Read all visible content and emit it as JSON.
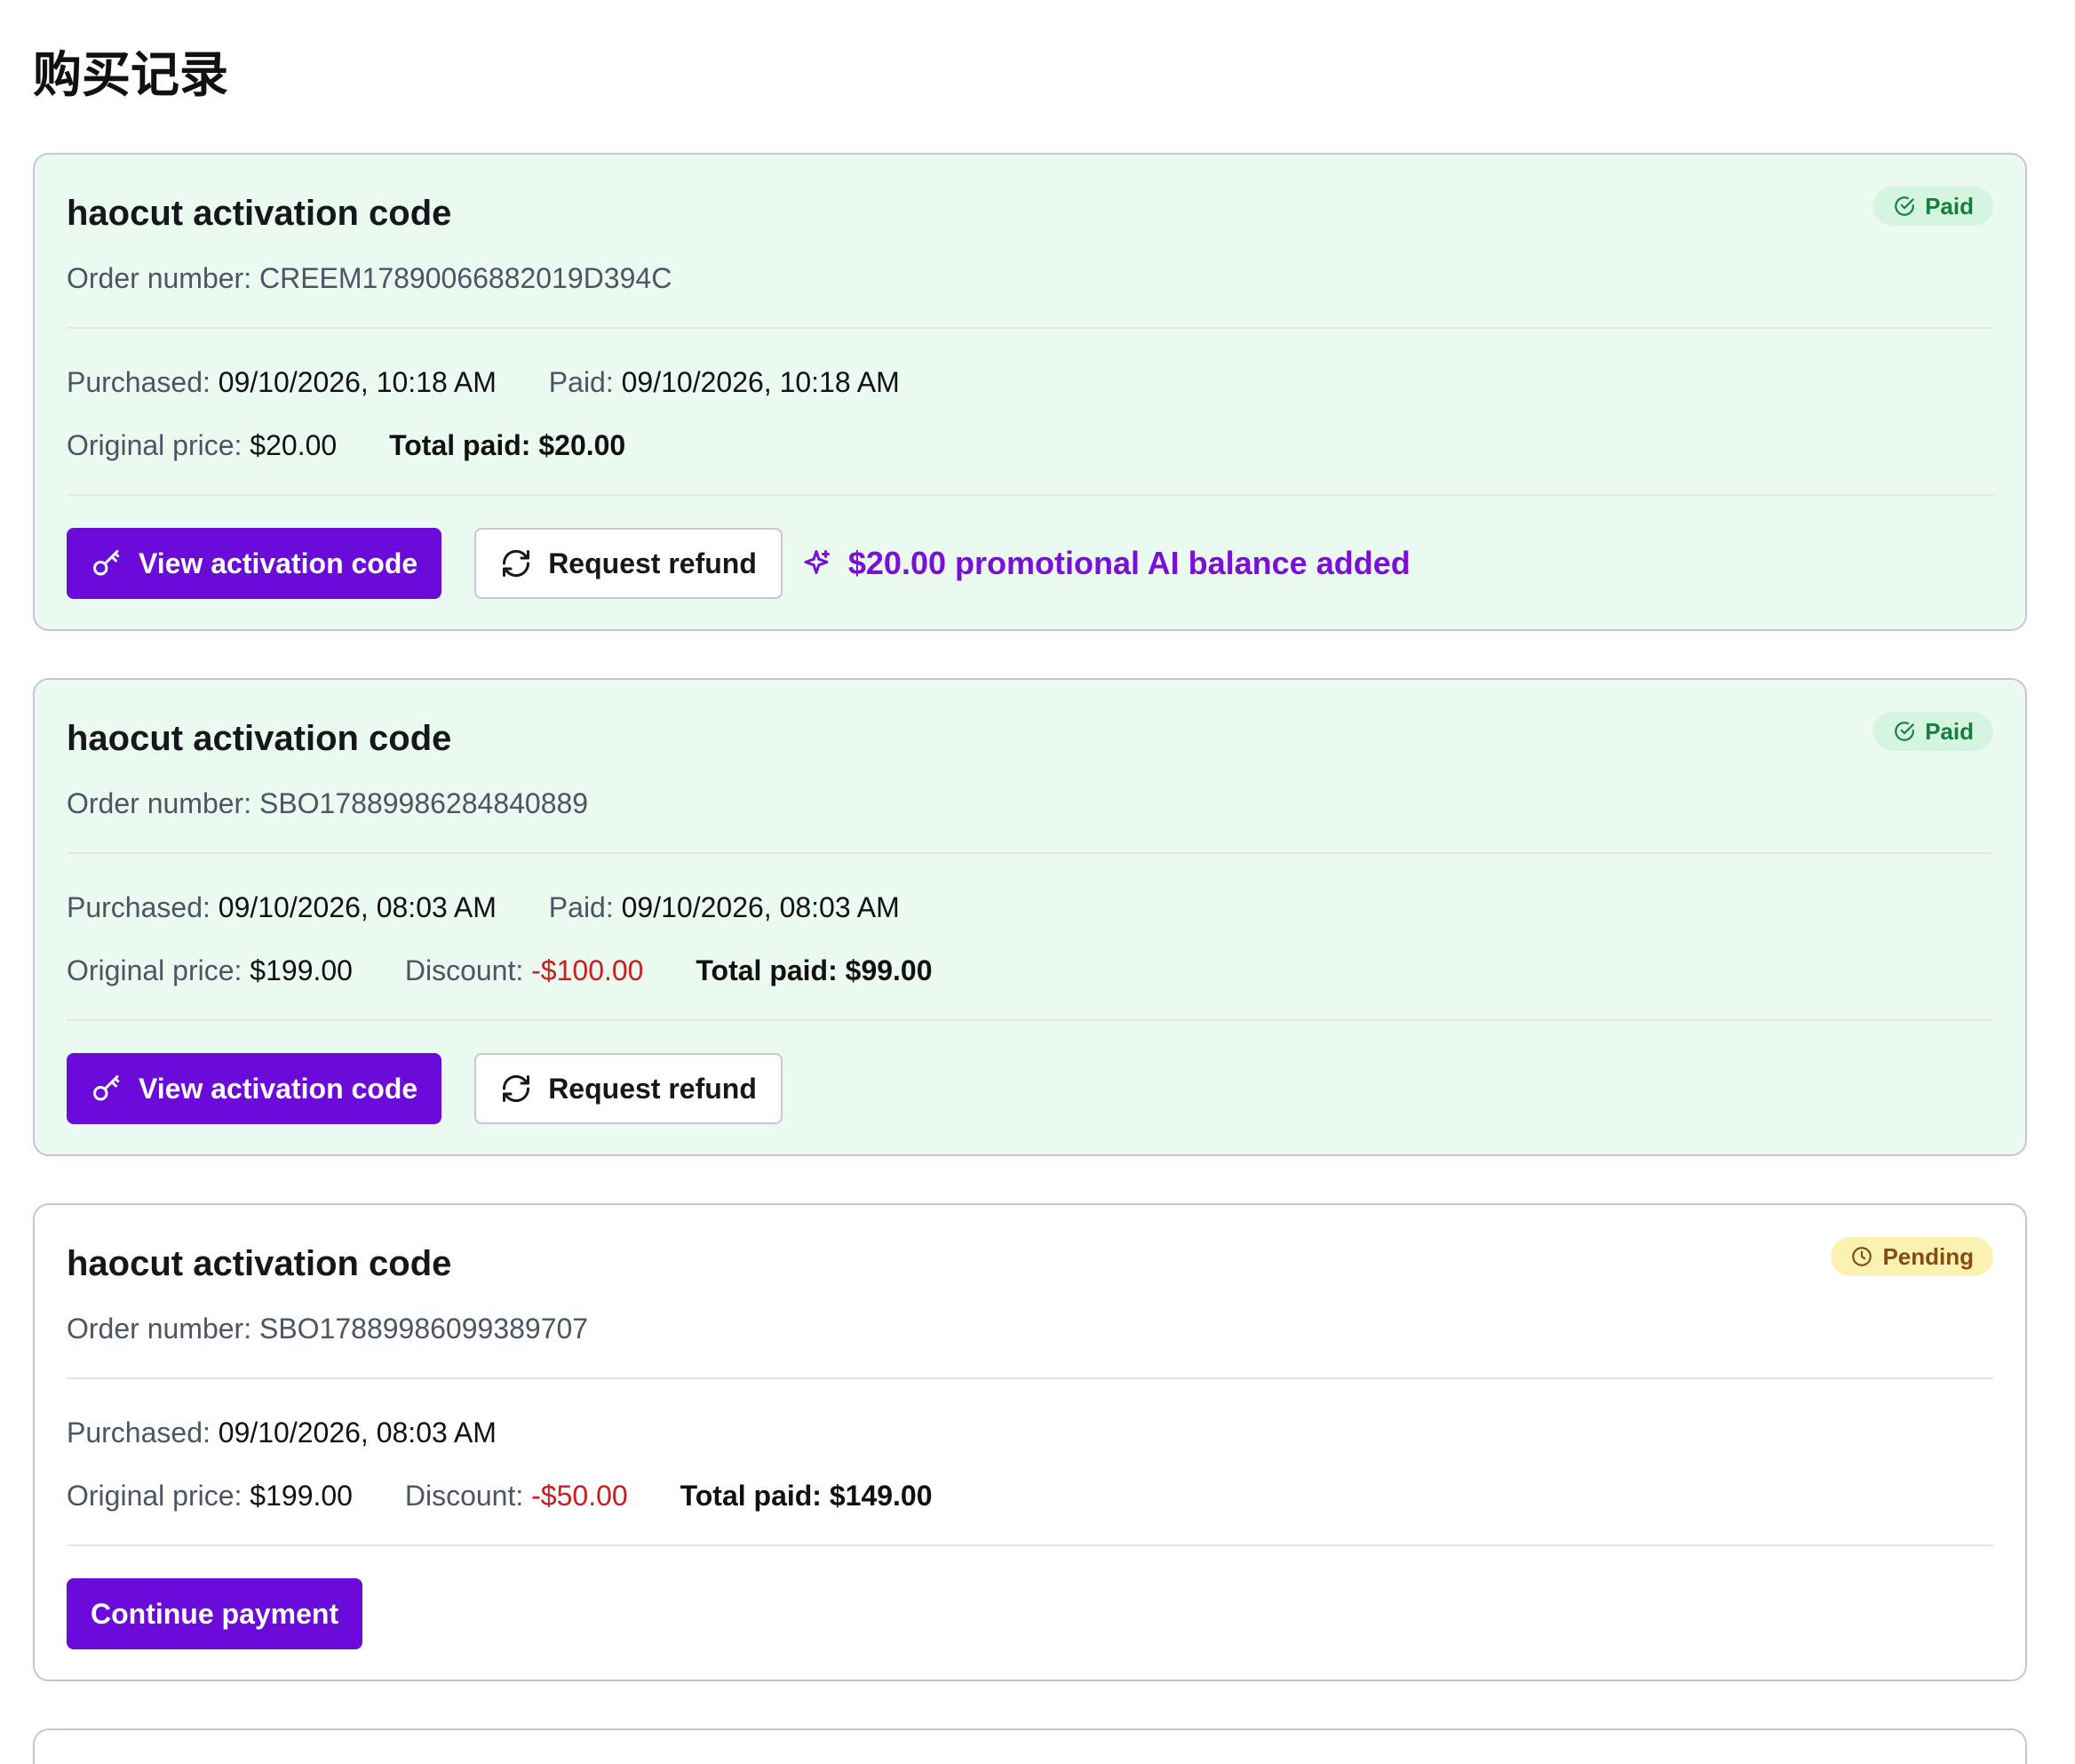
{
  "page": {
    "title": "购买记录"
  },
  "orders": [
    {
      "status": "paid",
      "status_label": "Paid",
      "title": "haocut activation code",
      "order_number": "Order number: CREEM17890066882019D394C",
      "purchased_label": "Purchased:",
      "purchased_value": "09/10/2026, 10:18 AM",
      "paid_label": "Paid:",
      "paid_value": "09/10/2026, 10:18 AM",
      "original_price_label": "Original price:",
      "original_price_value": "$20.00",
      "total_paid_label": "Total paid:",
      "total_paid_value": "$20.00",
      "primary_button": "View activation code",
      "refund_button": "Request refund",
      "promo_text": "$20.00 promotional AI balance added"
    },
    {
      "status": "paid",
      "status_label": "Paid",
      "title": "haocut activation code",
      "order_number": "Order number: SBO17889986284840889",
      "purchased_label": "Purchased:",
      "purchased_value": "09/10/2026, 08:03 AM",
      "paid_label": "Paid:",
      "paid_value": "09/10/2026, 08:03 AM",
      "original_price_label": "Original price:",
      "original_price_value": "$199.00",
      "discount_label": "Discount:",
      "discount_value": "-$100.00",
      "total_paid_label": "Total paid:",
      "total_paid_value": "$99.00",
      "primary_button": "View activation code",
      "refund_button": "Request refund"
    },
    {
      "status": "pending",
      "status_label": "Pending",
      "title": "haocut activation code",
      "order_number": "Order number: SBO17889986099389707",
      "purchased_label": "Purchased:",
      "purchased_value": "09/10/2026, 08:03 AM",
      "original_price_label": "Original price:",
      "original_price_value": "$199.00",
      "discount_label": "Discount:",
      "discount_value": "-$50.00",
      "total_paid_label": "Total paid:",
      "total_paid_value": "$149.00",
      "primary_button": "Continue payment"
    }
  ],
  "icons": {
    "paid_badge": "check-circle-icon",
    "pending_badge": "clock-icon",
    "view_code": "key-icon",
    "refund": "refresh-icon",
    "promo": "sparkle-icon"
  },
  "colors": {
    "accent": "#6a0bd9",
    "promo_text": "#7a10d6",
    "paid_card_bg": "#eafaf0",
    "paid_badge_bg": "#d6f5e1",
    "paid_badge_text": "#15803d",
    "pending_badge_bg": "#fbf1b3",
    "pending_badge_text": "#854d0e",
    "discount": "#c81e1e"
  }
}
